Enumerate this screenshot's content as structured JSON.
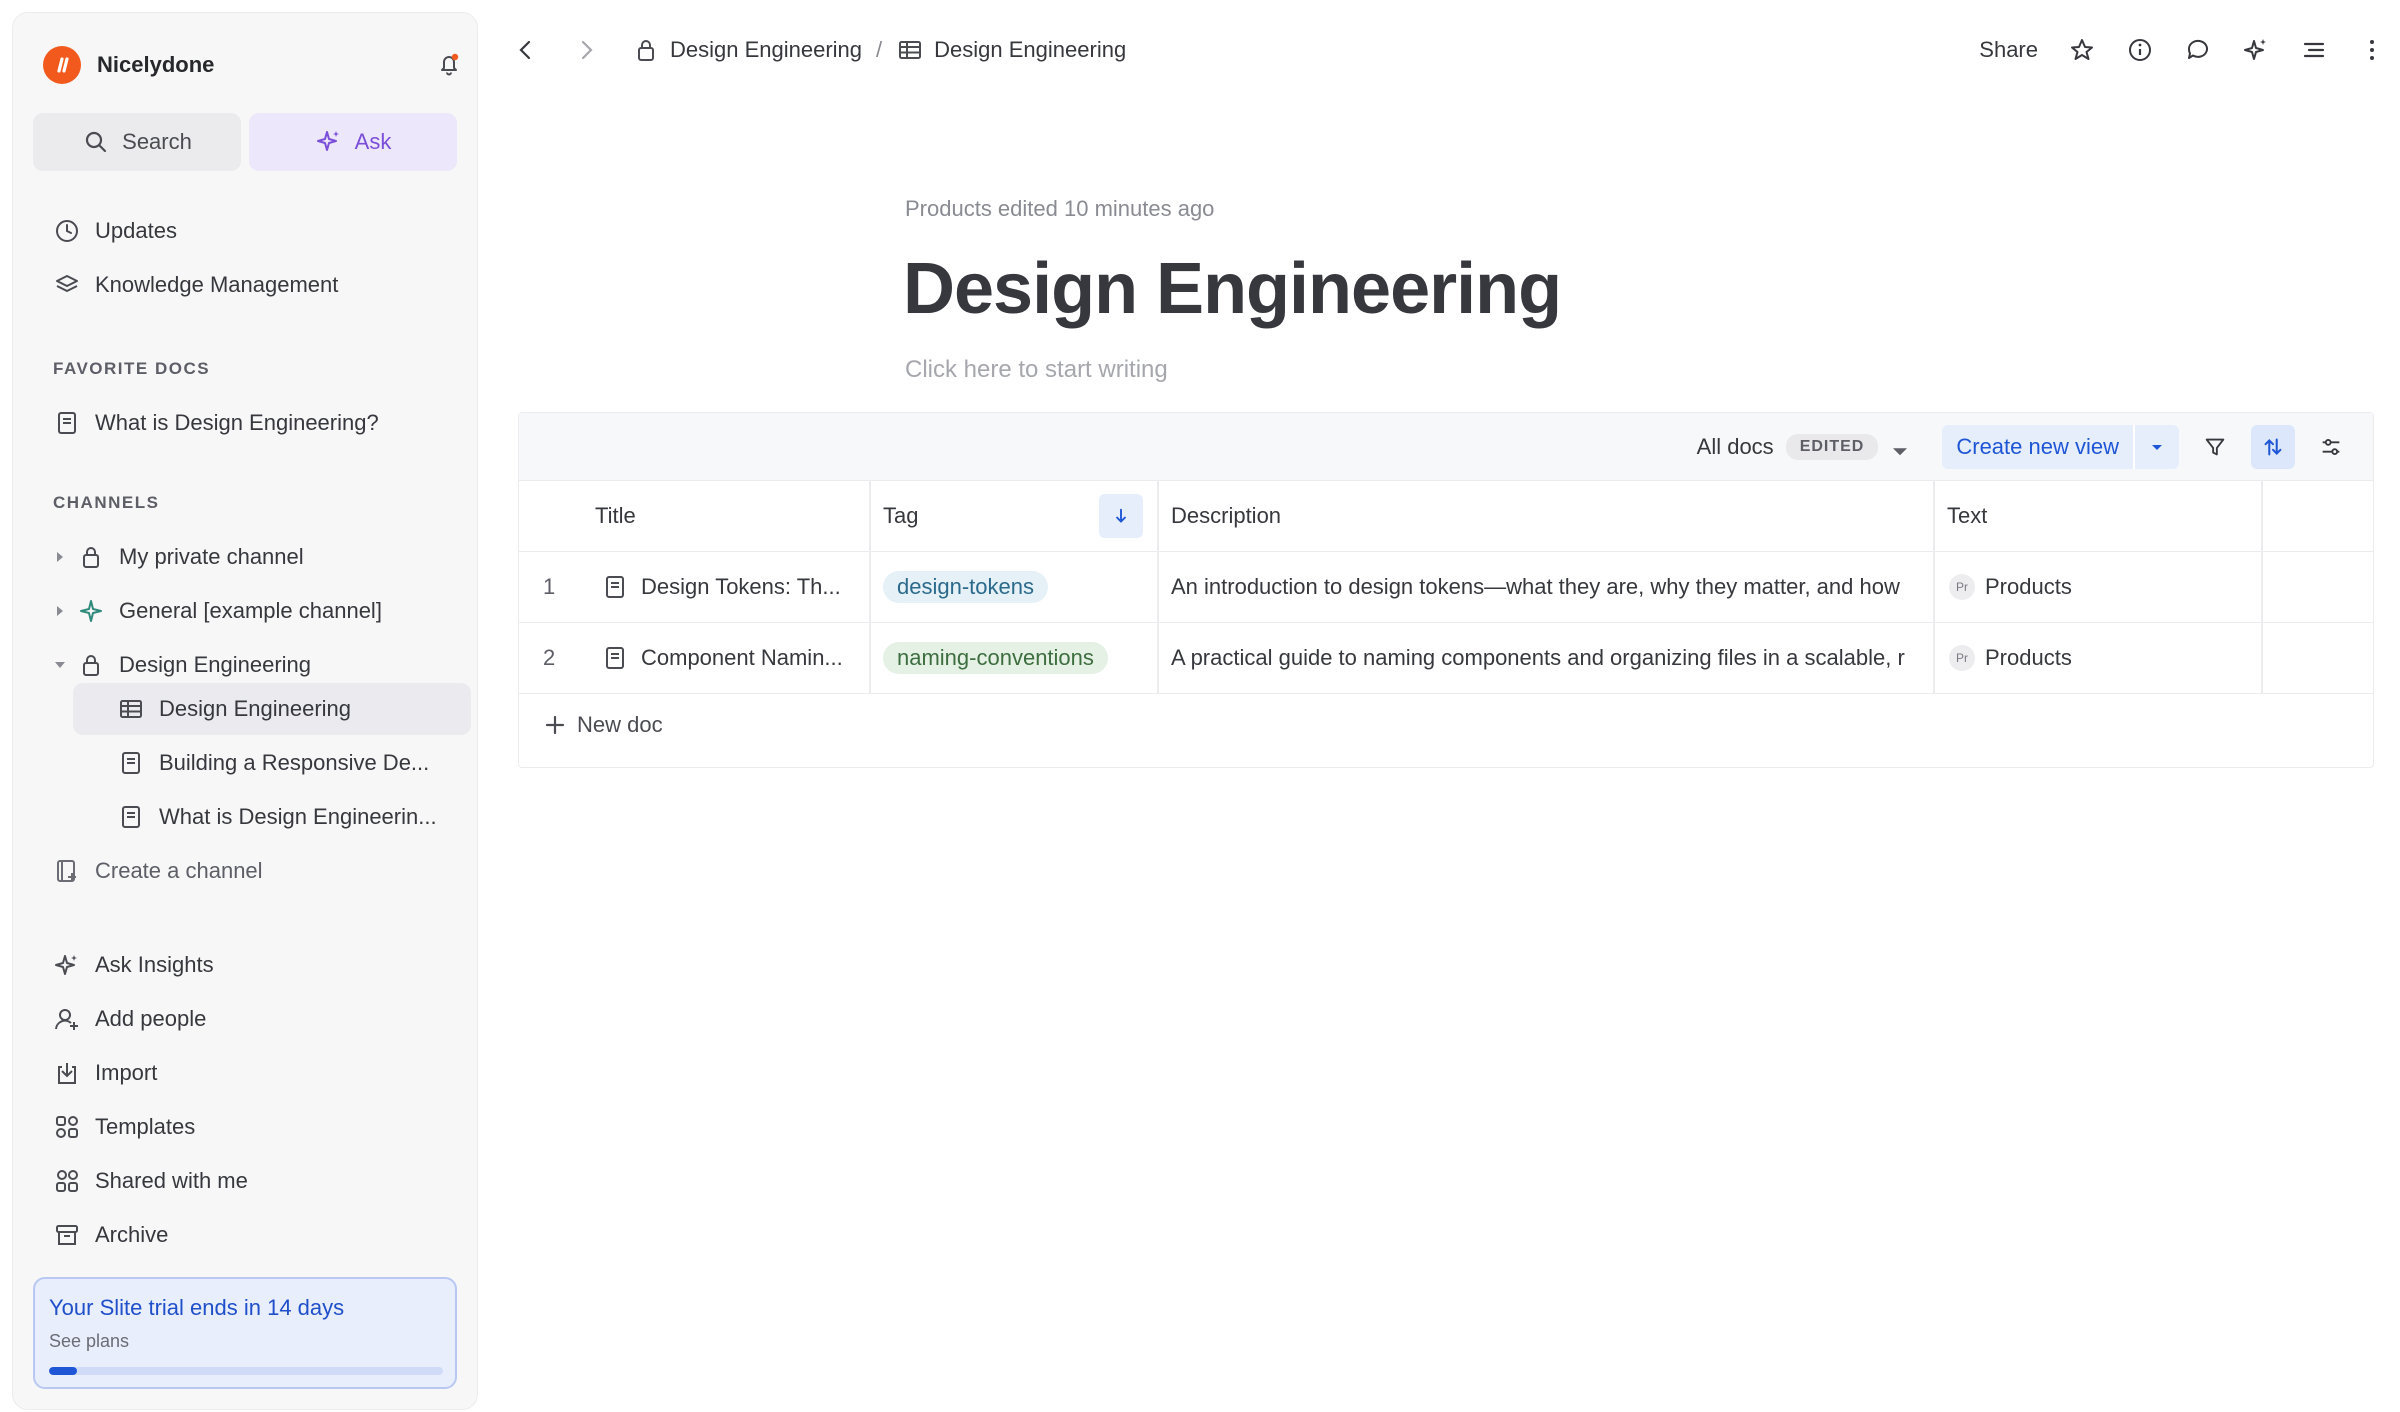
{
  "workspace": {
    "name": "Nicelydone"
  },
  "sidebar": {
    "search_label": "Search",
    "ask_label": "Ask",
    "top_items": [
      {
        "label": "Updates",
        "icon": "clock-icon"
      },
      {
        "label": "Knowledge Management",
        "icon": "layers-icon"
      }
    ],
    "favorites_header": "FAVORITE DOCS",
    "favorites": [
      {
        "label": "What is Design Engineering?",
        "icon": "doc-icon"
      }
    ],
    "channels_header": "CHANNELS",
    "channels": [
      {
        "label": "My private channel",
        "icon": "lock-icon",
        "expanded": false
      },
      {
        "label": "General [example channel]",
        "icon": "sparkle-icon",
        "expanded": false
      },
      {
        "label": "Design Engineering",
        "icon": "lock-icon",
        "expanded": true
      }
    ],
    "channel_children": [
      {
        "label": "Design Engineering",
        "icon": "table-icon",
        "selected": true
      },
      {
        "label": "Building a Responsive De...",
        "icon": "doc-icon"
      },
      {
        "label": "What is Design Engineerin...",
        "icon": "doc-icon"
      }
    ],
    "create_channel": "Create a channel",
    "bottom_items": [
      {
        "label": "Ask Insights",
        "icon": "sparkle-icon"
      },
      {
        "label": "Add people",
        "icon": "add-person-icon"
      },
      {
        "label": "Import",
        "icon": "import-icon"
      },
      {
        "label": "Templates",
        "icon": "templates-icon"
      },
      {
        "label": "Shared with me",
        "icon": "shared-icon"
      },
      {
        "label": "Archive",
        "icon": "archive-icon"
      }
    ],
    "trial": {
      "title": "Your Slite trial ends in 14 days",
      "link": "See plans",
      "progress": 0.07
    }
  },
  "topbar": {
    "breadcrumb": [
      {
        "label": "Design Engineering",
        "icon": "lock-icon"
      },
      {
        "label": "Design Engineering",
        "icon": "table-icon"
      }
    ],
    "separator": "/",
    "share_label": "Share"
  },
  "doc": {
    "meta": "Products edited 10 minutes ago",
    "title": "Design Engineering",
    "placeholder": "Click here to start writing"
  },
  "table": {
    "view_name": "All docs",
    "edited_badge": "EDITED",
    "create_view": "Create new view",
    "columns": [
      "Title",
      "Tag",
      "Description",
      "Text"
    ],
    "rows": [
      {
        "num": "1",
        "title": "Design Tokens: Th...",
        "tag": "design-tokens",
        "tag_color": "#e5f1f7",
        "description": "An introduction to design tokens—what they are, why they matter, and how",
        "text_badge": "Pr",
        "text": "Products"
      },
      {
        "num": "2",
        "title": "Component Namin...",
        "tag": "naming-conventions",
        "tag_color": "#e5f1e5",
        "description": "A practical guide to naming components and organizing files in a scalable, r",
        "text_badge": "Pr",
        "text": "Products"
      }
    ],
    "new_doc": "New doc"
  },
  "colors": {
    "brand": "#f25a1d",
    "accent": "#1f56d6",
    "ask": "#7a4ed8"
  }
}
